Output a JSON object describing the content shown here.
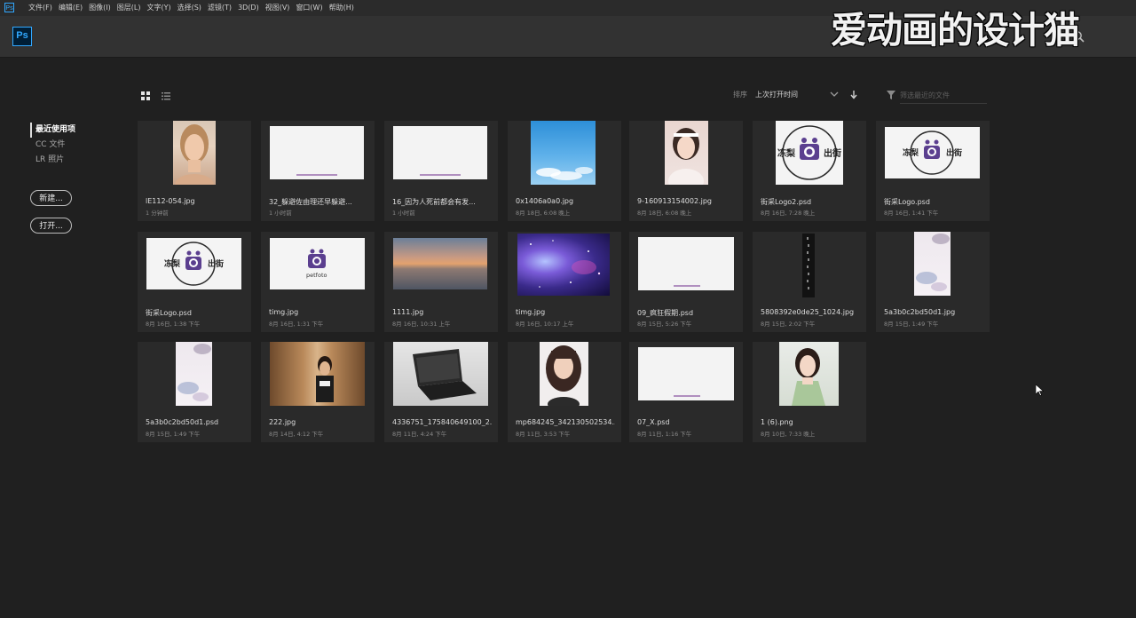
{
  "menubar": {
    "app_icon": "Ps",
    "items": [
      "文件(F)",
      "编辑(E)",
      "图像(I)",
      "图层(L)",
      "文字(Y)",
      "选择(S)",
      "滤镜(T)",
      "3D(D)",
      "视图(V)",
      "窗口(W)",
      "帮助(H)"
    ]
  },
  "appbar": {
    "logo": "Ps",
    "search_icon": "search-icon"
  },
  "watermark": "爱动画的设计猫",
  "nav": {
    "items": [
      "最近使用项",
      "CC 文件",
      "LR 照片"
    ],
    "new_button": "新建...",
    "open_button": "打开..."
  },
  "toolbar": {
    "sort_label": "排序",
    "sort_value": "上次打开时间",
    "filter_placeholder": "筛选最近的文件"
  },
  "files": [
    {
      "name": "lE112-054.jpg",
      "time": "1 分钟前"
    },
    {
      "name": "32_躲避佐由理还早躲避...",
      "time": "1 小时前"
    },
    {
      "name": "16_因为人死前都会有发...",
      "time": "1 小时前"
    },
    {
      "name": "0x1406a0a0.jpg",
      "time": "8月 18日, 6:08 晚上"
    },
    {
      "name": "9-160913154002.jpg",
      "time": "8月 18日, 6:08 晚上"
    },
    {
      "name": "街采Logo2.psd",
      "time": "8月 16日, 7:28 晚上"
    },
    {
      "name": "街采Logo.psd",
      "time": "8月 16日, 1:41 下午"
    },
    {
      "name": "街采Logo.psd",
      "time": "8月 16日, 1:38 下午"
    },
    {
      "name": "timg.jpg",
      "time": "8月 16日, 1:31 下午"
    },
    {
      "name": "1111.jpg",
      "time": "8月 16日, 10:31 上午"
    },
    {
      "name": "timg.jpg",
      "time": "8月 16日, 10:17 上午"
    },
    {
      "name": "09_疯狂假期.psd",
      "time": "8月 15日, 5:26 下午"
    },
    {
      "name": "5808392e0de25_1024.jpg",
      "time": "8月 15日, 2:02 下午"
    },
    {
      "name": "5a3b0c2bd50d1.jpg",
      "time": "8月 15日, 1:49 下午"
    },
    {
      "name": "5a3b0c2bd50d1.psd",
      "time": "8月 15日, 1:49 下午"
    },
    {
      "name": "222.jpg",
      "time": "8月 14日, 4:12 下午"
    },
    {
      "name": "4336751_175840649100_2...",
      "time": "8月 11日, 4:24 下午"
    },
    {
      "name": "mp684245_342130502534...",
      "time": "8月 11日, 3:53 下午"
    },
    {
      "name": "07_X.psd",
      "time": "8月 11日, 1:16 下午"
    },
    {
      "name": "1 (6).png",
      "time": "8月 10日, 7:33 晚上"
    }
  ],
  "logo_text": {
    "left": "冻梨",
    "right": "出街",
    "petfoto": "petfoto"
  },
  "colors": {
    "background": "#202020",
    "card": "#2a2a2a",
    "accent_ps": "#31a8ff",
    "logo_purple": "#5b3f8f"
  }
}
